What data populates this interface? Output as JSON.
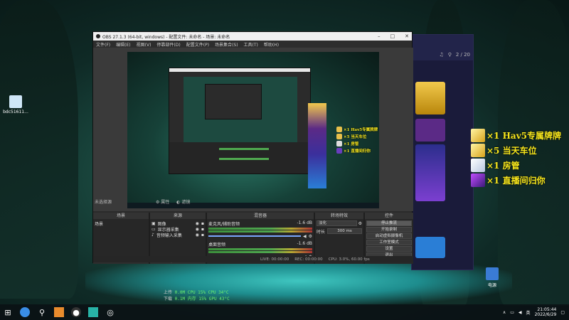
{
  "desktop": {
    "icons": [
      {
        "label": "bdc51611...",
        "icon": "file-icon"
      },
      {
        "label": "电源",
        "icon": "power-icon"
      }
    ],
    "hardware_stats": {
      "upload_label": "上传",
      "upload_value": "0.0M",
      "download_label": "下载",
      "download_value": "0.1M",
      "cpu_usage": "CPU 15%",
      "cpu_temp": "CPU 34°C",
      "mem_usage": "内存 15%",
      "gpu_temp": "GPU 43°C"
    }
  },
  "obs": {
    "title": "OBS 27.1.3 (64-bit, windows) - 配置文件: 未命名 - 场景: 未命名",
    "menu": [
      "文件(F)",
      "编辑(E)",
      "视图(V)",
      "停靠部件(D)",
      "配置文件(P)",
      "场景集合(S)",
      "工具(T)",
      "帮助(H)"
    ],
    "no_source_label": "未选择源",
    "props_label": "属性",
    "filters_label": "滤镜",
    "scenes": {
      "header": "场景",
      "items": [
        "场景"
      ]
    },
    "sources": {
      "header": "来源",
      "items": [
        "图像",
        "显示器采集",
        "音频输入采集"
      ]
    },
    "mixer": {
      "header": "混音器",
      "channels": [
        {
          "name": "麦克风/辅助音频",
          "db": "-1.6 dB"
        },
        {
          "name": "桌面音频",
          "db": "-1.6 dB"
        }
      ]
    },
    "transitions": {
      "header": "转场特效",
      "type": "淡化",
      "duration_label": "时长",
      "duration": "300 ms"
    },
    "controls": {
      "header": "控件",
      "buttons": [
        "停止推流",
        "开始录制",
        "启动虚拟摄像机",
        "工作室模式",
        "设置",
        "退出"
      ]
    },
    "status": {
      "live": "LIVE: 00:00:00",
      "rec": "REC: 00:00:00",
      "cpu": "CPU: 3.0%, 60.00 fps"
    }
  },
  "gifts": [
    {
      "text": "×1  Hav5专属牌牌",
      "icon": "gold-bar-icon"
    },
    {
      "text": "×5  当天车位",
      "icon": "gold-bar-icon"
    },
    {
      "text": "×1  房管",
      "icon": "badge-icon"
    },
    {
      "text": "×1  直播间归你",
      "icon": "crown-icon"
    }
  ],
  "right_app": {
    "counter": "2 / 20"
  },
  "taskbar": {
    "time": "21:05:44",
    "date": "2022/6/29",
    "lang": "英"
  },
  "colors": {
    "gift_text": "#f8e71c",
    "obs_bg": "#2b2b2b",
    "desktop_bg": "#1b4c42"
  }
}
